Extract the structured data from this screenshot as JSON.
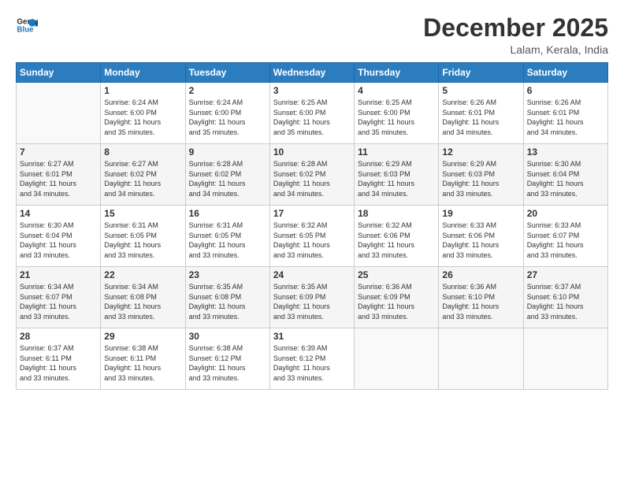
{
  "logo": {
    "line1": "General",
    "line2": "Blue"
  },
  "title": "December 2025",
  "location": "Lalam, Kerala, India",
  "days_of_week": [
    "Sunday",
    "Monday",
    "Tuesday",
    "Wednesday",
    "Thursday",
    "Friday",
    "Saturday"
  ],
  "weeks": [
    [
      {
        "num": "",
        "info": ""
      },
      {
        "num": "1",
        "info": "Sunrise: 6:24 AM\nSunset: 6:00 PM\nDaylight: 11 hours\nand 35 minutes."
      },
      {
        "num": "2",
        "info": "Sunrise: 6:24 AM\nSunset: 6:00 PM\nDaylight: 11 hours\nand 35 minutes."
      },
      {
        "num": "3",
        "info": "Sunrise: 6:25 AM\nSunset: 6:00 PM\nDaylight: 11 hours\nand 35 minutes."
      },
      {
        "num": "4",
        "info": "Sunrise: 6:25 AM\nSunset: 6:00 PM\nDaylight: 11 hours\nand 35 minutes."
      },
      {
        "num": "5",
        "info": "Sunrise: 6:26 AM\nSunset: 6:01 PM\nDaylight: 11 hours\nand 34 minutes."
      },
      {
        "num": "6",
        "info": "Sunrise: 6:26 AM\nSunset: 6:01 PM\nDaylight: 11 hours\nand 34 minutes."
      }
    ],
    [
      {
        "num": "7",
        "info": "Sunrise: 6:27 AM\nSunset: 6:01 PM\nDaylight: 11 hours\nand 34 minutes."
      },
      {
        "num": "8",
        "info": "Sunrise: 6:27 AM\nSunset: 6:02 PM\nDaylight: 11 hours\nand 34 minutes."
      },
      {
        "num": "9",
        "info": "Sunrise: 6:28 AM\nSunset: 6:02 PM\nDaylight: 11 hours\nand 34 minutes."
      },
      {
        "num": "10",
        "info": "Sunrise: 6:28 AM\nSunset: 6:02 PM\nDaylight: 11 hours\nand 34 minutes."
      },
      {
        "num": "11",
        "info": "Sunrise: 6:29 AM\nSunset: 6:03 PM\nDaylight: 11 hours\nand 34 minutes."
      },
      {
        "num": "12",
        "info": "Sunrise: 6:29 AM\nSunset: 6:03 PM\nDaylight: 11 hours\nand 33 minutes."
      },
      {
        "num": "13",
        "info": "Sunrise: 6:30 AM\nSunset: 6:04 PM\nDaylight: 11 hours\nand 33 minutes."
      }
    ],
    [
      {
        "num": "14",
        "info": "Sunrise: 6:30 AM\nSunset: 6:04 PM\nDaylight: 11 hours\nand 33 minutes."
      },
      {
        "num": "15",
        "info": "Sunrise: 6:31 AM\nSunset: 6:05 PM\nDaylight: 11 hours\nand 33 minutes."
      },
      {
        "num": "16",
        "info": "Sunrise: 6:31 AM\nSunset: 6:05 PM\nDaylight: 11 hours\nand 33 minutes."
      },
      {
        "num": "17",
        "info": "Sunrise: 6:32 AM\nSunset: 6:05 PM\nDaylight: 11 hours\nand 33 minutes."
      },
      {
        "num": "18",
        "info": "Sunrise: 6:32 AM\nSunset: 6:06 PM\nDaylight: 11 hours\nand 33 minutes."
      },
      {
        "num": "19",
        "info": "Sunrise: 6:33 AM\nSunset: 6:06 PM\nDaylight: 11 hours\nand 33 minutes."
      },
      {
        "num": "20",
        "info": "Sunrise: 6:33 AM\nSunset: 6:07 PM\nDaylight: 11 hours\nand 33 minutes."
      }
    ],
    [
      {
        "num": "21",
        "info": "Sunrise: 6:34 AM\nSunset: 6:07 PM\nDaylight: 11 hours\nand 33 minutes."
      },
      {
        "num": "22",
        "info": "Sunrise: 6:34 AM\nSunset: 6:08 PM\nDaylight: 11 hours\nand 33 minutes."
      },
      {
        "num": "23",
        "info": "Sunrise: 6:35 AM\nSunset: 6:08 PM\nDaylight: 11 hours\nand 33 minutes."
      },
      {
        "num": "24",
        "info": "Sunrise: 6:35 AM\nSunset: 6:09 PM\nDaylight: 11 hours\nand 33 minutes."
      },
      {
        "num": "25",
        "info": "Sunrise: 6:36 AM\nSunset: 6:09 PM\nDaylight: 11 hours\nand 33 minutes."
      },
      {
        "num": "26",
        "info": "Sunrise: 6:36 AM\nSunset: 6:10 PM\nDaylight: 11 hours\nand 33 minutes."
      },
      {
        "num": "27",
        "info": "Sunrise: 6:37 AM\nSunset: 6:10 PM\nDaylight: 11 hours\nand 33 minutes."
      }
    ],
    [
      {
        "num": "28",
        "info": "Sunrise: 6:37 AM\nSunset: 6:11 PM\nDaylight: 11 hours\nand 33 minutes."
      },
      {
        "num": "29",
        "info": "Sunrise: 6:38 AM\nSunset: 6:11 PM\nDaylight: 11 hours\nand 33 minutes."
      },
      {
        "num": "30",
        "info": "Sunrise: 6:38 AM\nSunset: 6:12 PM\nDaylight: 11 hours\nand 33 minutes."
      },
      {
        "num": "31",
        "info": "Sunrise: 6:39 AM\nSunset: 6:12 PM\nDaylight: 11 hours\nand 33 minutes."
      },
      {
        "num": "",
        "info": ""
      },
      {
        "num": "",
        "info": ""
      },
      {
        "num": "",
        "info": ""
      }
    ]
  ]
}
